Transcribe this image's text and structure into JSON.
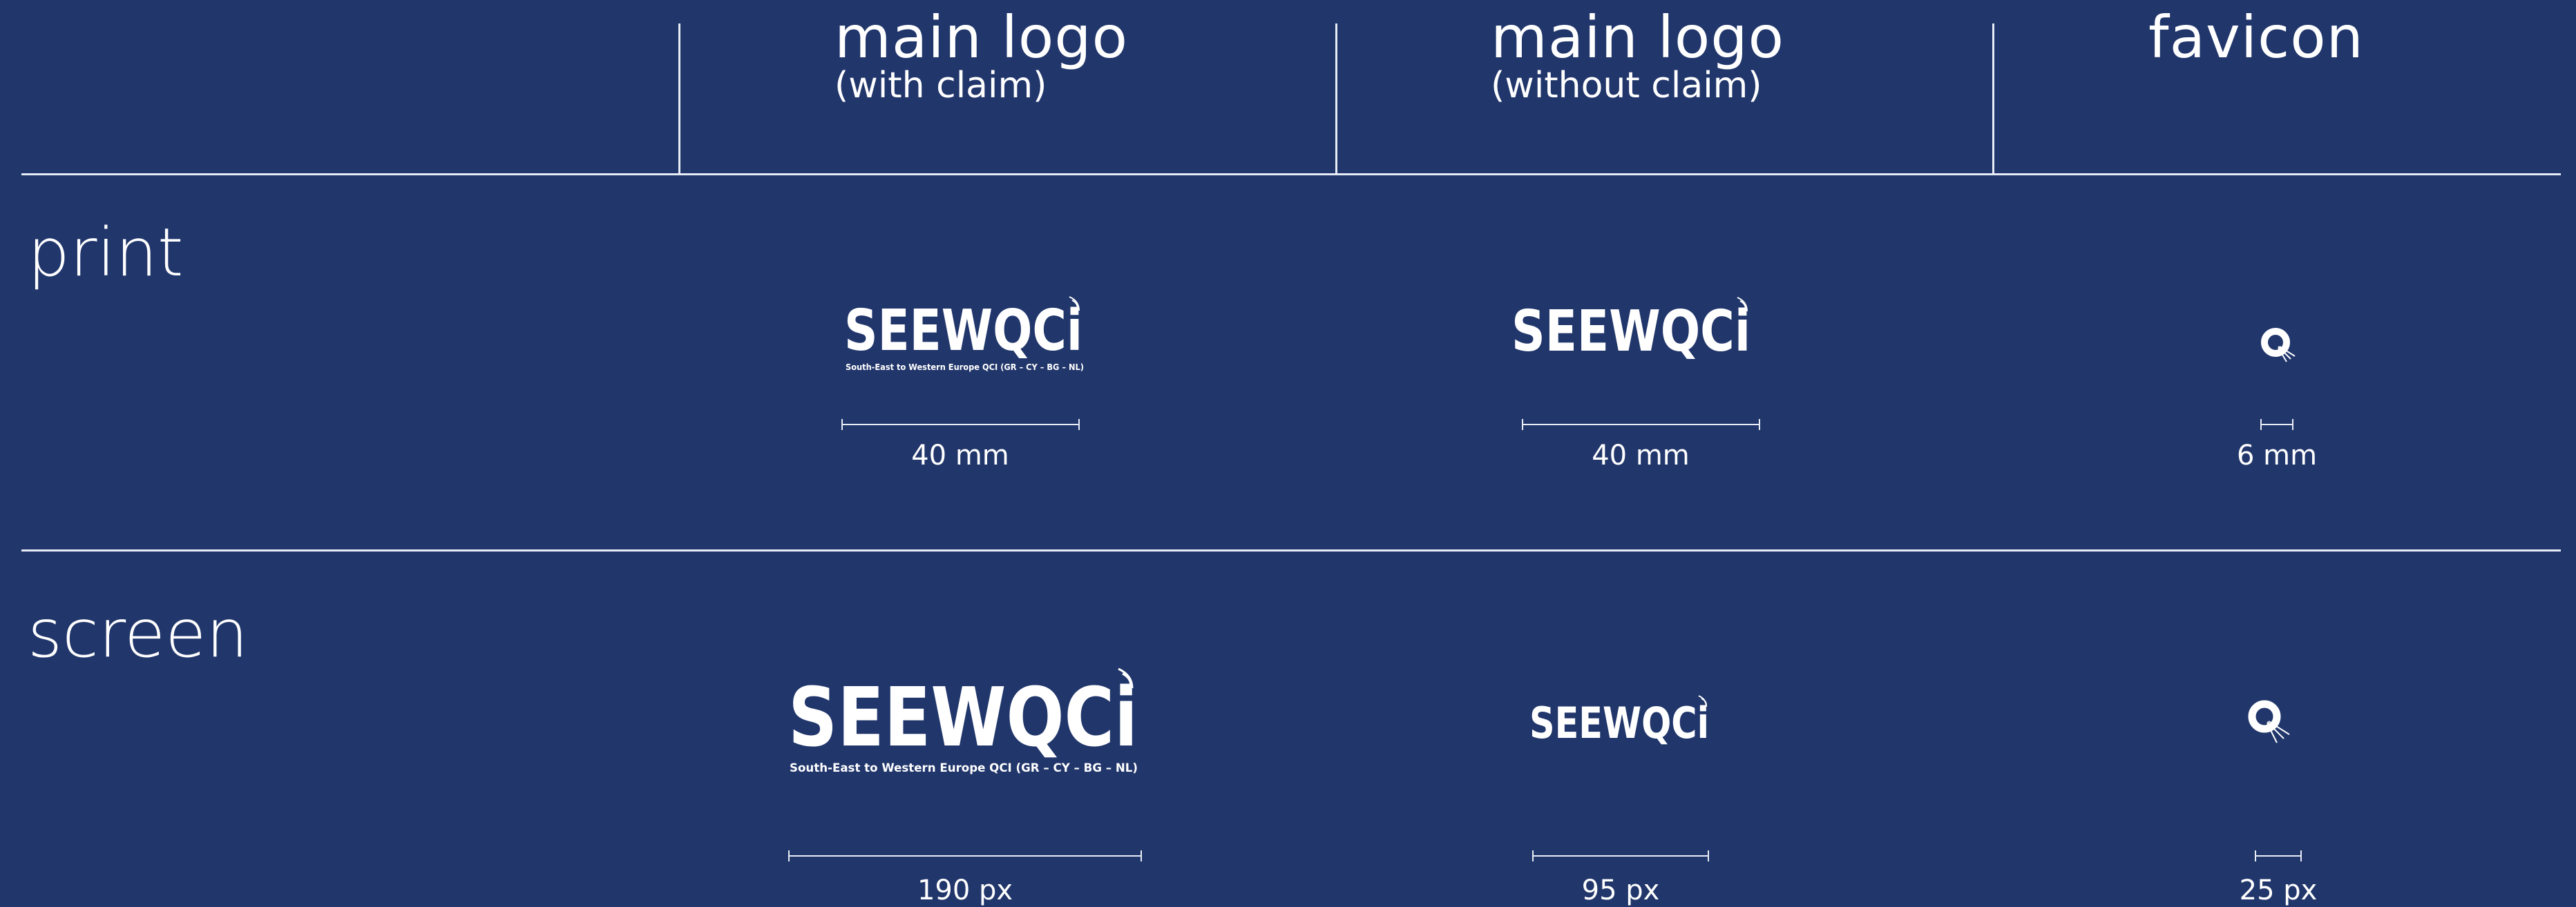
{
  "columns": [
    {
      "title": "main logo",
      "subtitle": "(with claim)"
    },
    {
      "title": "main logo",
      "subtitle": "(without claim)"
    },
    {
      "title": "favicon",
      "subtitle": ""
    }
  ],
  "rows": {
    "print": {
      "label": "print",
      "sizes": [
        "40 mm",
        "40 mm",
        "6 mm"
      ]
    },
    "screen": {
      "label": "screen",
      "sizes": [
        "190 px",
        "95 px",
        "25 px"
      ]
    }
  },
  "logo": {
    "wordmark": "SEEWQCi",
    "claim": "South-East to Western Europe QCI (GR – CY – BG – NL)",
    "favicon_letter": "Q"
  },
  "colors": {
    "background": "#21366b",
    "foreground": "#ffffff",
    "rule": "#e8ecf5"
  }
}
